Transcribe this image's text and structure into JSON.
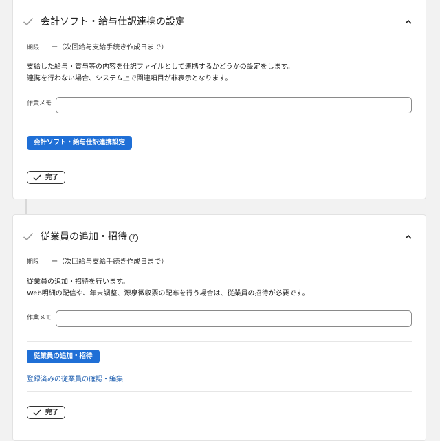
{
  "sections": [
    {
      "title": "会計ソフト・給与仕訳連携の設定",
      "deadline_label": "期限",
      "deadline_value": "ー（次回給与支給手続き作成日まで）",
      "description_lines": [
        "支給した給与・賞与等の内容を仕訳ファイルとして連携するかどうかの設定をします。",
        "連携を行わない場合、システム上で関連項目が非表示となります。"
      ],
      "memo_label": "作業メモ",
      "memo_value": "",
      "action_button": "会計ソフト・給与仕訳連携設定",
      "done_button": "完了"
    },
    {
      "title": "従業員の追加・招待",
      "help_icon": "?",
      "deadline_label": "期限",
      "deadline_value": "ー（次回給与支給手続き作成日まで）",
      "description_lines": [
        "従業員の追加・招待を行います。",
        "Web明細の配信や、年末調整、源泉徴収票の配布を行う場合は、従業員の招待が必要です。"
      ],
      "memo_label": "作業メモ",
      "memo_value": "",
      "action_button": "従業員の追加・招待",
      "link_text": "登録済みの従業員の確認・編集",
      "done_button": "完了"
    }
  ],
  "icons": {
    "section_status": "check-icon",
    "collapse": "chevron-up-icon",
    "done": "check-icon"
  },
  "colors": {
    "accent": "#1f6fd6",
    "link": "#1f5fb0",
    "check_gray": "#9a9a9a"
  }
}
